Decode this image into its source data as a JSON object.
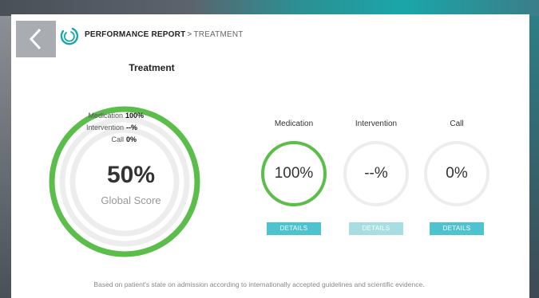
{
  "header": {
    "breadcrumb_main": "PERFORMANCE REPORT",
    "breadcrumb_sep": ">",
    "breadcrumb_current": "TREATMENT"
  },
  "section_title": "Treatment",
  "global": {
    "score": "50%",
    "label": "Global Score",
    "legend": [
      {
        "label": "Medication",
        "value": "100%"
      },
      {
        "label": "Intervention",
        "value": "--%"
      },
      {
        "label": "Call",
        "value": "0%"
      }
    ],
    "fractions": {
      "medication": 1.0,
      "intervention": 0,
      "call": 0
    }
  },
  "metrics": [
    {
      "title": "Medication",
      "value": "100%",
      "fraction": 1.0,
      "button": "DETAILS",
      "button_enabled": true
    },
    {
      "title": "Intervention",
      "value": "--%",
      "fraction": 0,
      "button": "DETAILS",
      "button_enabled": false
    },
    {
      "title": "Call",
      "value": "0%",
      "fraction": 0,
      "button": "DETAILS",
      "button_enabled": true
    }
  ],
  "footer": "Based on patient's state on admission according to internationally accepted guidelines and scientific evidence.",
  "colors": {
    "accent_green": "#5bbd4a",
    "ring_track": "#ededed",
    "button_active": "#4cc3cf",
    "button_disabled": "#a8dde2"
  }
}
